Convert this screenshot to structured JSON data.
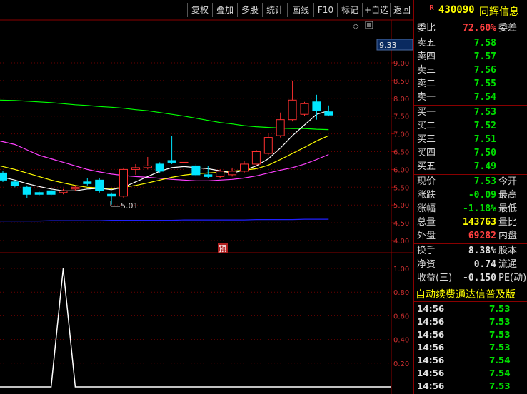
{
  "toolbar": {
    "buttons": [
      "复权",
      "叠加",
      "多股",
      "统计",
      "画线",
      "F10",
      "标记",
      "+自选",
      "返回"
    ]
  },
  "price_axis": {
    "top_label": "9.33",
    "ticks": [
      "9.00",
      "8.50",
      "8.00",
      "7.50",
      "7.00",
      "6.50",
      "6.00",
      "5.50",
      "5.00",
      "4.50",
      "4.00"
    ]
  },
  "chart_annot": {
    "low_marker": "5.01",
    "pre_marker": "预"
  },
  "sub_axis": {
    "ticks": [
      "1.00",
      "0.80",
      "0.60",
      "0.40",
      "0.20"
    ]
  },
  "header": {
    "badge": "R",
    "code": "430090",
    "name": "同辉信息"
  },
  "weibi": {
    "label": "委比",
    "value": "72.60%",
    "label2": "委差"
  },
  "sell": [
    {
      "label": "卖五",
      "price": "7.58"
    },
    {
      "label": "卖四",
      "price": "7.57"
    },
    {
      "label": "卖三",
      "price": "7.56"
    },
    {
      "label": "卖二",
      "price": "7.55"
    },
    {
      "label": "卖一",
      "price": "7.54"
    }
  ],
  "buy": [
    {
      "label": "买一",
      "price": "7.53"
    },
    {
      "label": "买二",
      "price": "7.52"
    },
    {
      "label": "买三",
      "price": "7.51"
    },
    {
      "label": "买四",
      "price": "7.50"
    },
    {
      "label": "买五",
      "price": "7.49"
    }
  ],
  "quote": [
    {
      "label": "现价",
      "value": "7.53",
      "label2": "今开",
      "color": "grn"
    },
    {
      "label": "涨跌",
      "value": "-0.09",
      "label2": "最高",
      "color": "grn"
    },
    {
      "label": "涨幅",
      "value": "-1.18%",
      "label2": "最低",
      "color": "grn"
    },
    {
      "label": "总量",
      "value": "143763",
      "label2": "量比",
      "color": "yel"
    },
    {
      "label": "外盘",
      "value": "69282",
      "label2": "内盘",
      "color": "red"
    }
  ],
  "stats": [
    {
      "label": "换手",
      "value": "8.38%",
      "label2": "股本"
    },
    {
      "label": "净资",
      "value": "0.74",
      "label2": "流通"
    },
    {
      "label": "收益(三)",
      "value": "-0.150",
      "label2": "PE(动)"
    }
  ],
  "notice": "自动续费通达信普及版",
  "ticks": [
    {
      "time": "14:56",
      "price": "7.53"
    },
    {
      "time": "14:56",
      "price": "7.53"
    },
    {
      "time": "14:56",
      "price": "7.53"
    },
    {
      "time": "14:56",
      "price": "7.53"
    },
    {
      "time": "14:56",
      "price": "7.54"
    },
    {
      "time": "14:56",
      "price": "7.54"
    },
    {
      "time": "14:56",
      "price": "7.53"
    }
  ],
  "colors": {
    "up": "#ff3030",
    "down": "#00e5ff",
    "ma5": "#ffffff",
    "ma10": "#ffff00",
    "ma20": "#ff40ff",
    "ma60": "#00ff00",
    "ma250": "#2020ff"
  },
  "chart_data": {
    "type": "candlestick",
    "ylim": [
      4.0,
      9.33
    ],
    "candles": [
      {
        "o": 5.9,
        "c": 5.7,
        "h": 5.95,
        "l": 5.65
      },
      {
        "o": 5.65,
        "c": 5.55,
        "h": 5.7,
        "l": 5.5
      },
      {
        "o": 5.5,
        "c": 5.3,
        "h": 5.55,
        "l": 5.2
      },
      {
        "o": 5.35,
        "c": 5.3,
        "h": 5.4,
        "l": 5.25
      },
      {
        "o": 5.4,
        "c": 5.3,
        "h": 5.45,
        "l": 5.25
      },
      {
        "o": 5.35,
        "c": 5.4,
        "h": 5.45,
        "l": 5.3
      },
      {
        "o": 5.45,
        "c": 5.5,
        "h": 5.55,
        "l": 5.4
      },
      {
        "o": 5.65,
        "c": 5.6,
        "h": 5.75,
        "l": 5.55
      },
      {
        "o": 5.7,
        "c": 5.4,
        "h": 5.75,
        "l": 5.35
      },
      {
        "o": 5.3,
        "c": 5.25,
        "h": 5.35,
        "l": 5.01
      },
      {
        "o": 5.25,
        "c": 6.0,
        "h": 6.05,
        "l": 5.2
      },
      {
        "o": 6.0,
        "c": 6.05,
        "h": 6.15,
        "l": 5.85
      },
      {
        "o": 6.05,
        "c": 6.1,
        "h": 6.35,
        "l": 6.0
      },
      {
        "o": 6.15,
        "c": 5.95,
        "h": 6.2,
        "l": 5.9
      },
      {
        "o": 6.25,
        "c": 6.2,
        "h": 6.95,
        "l": 6.15
      },
      {
        "o": 6.2,
        "c": 6.2,
        "h": 6.3,
        "l": 6.1
      },
      {
        "o": 6.1,
        "c": 5.85,
        "h": 6.15,
        "l": 5.8
      },
      {
        "o": 5.85,
        "c": 5.8,
        "h": 6.1,
        "l": 5.75
      },
      {
        "o": 5.8,
        "c": 5.95,
        "h": 6.0,
        "l": 5.75
      },
      {
        "o": 5.85,
        "c": 5.95,
        "h": 6.05,
        "l": 5.8
      },
      {
        "o": 5.95,
        "c": 6.15,
        "h": 6.25,
        "l": 5.9
      },
      {
        "o": 6.15,
        "c": 6.5,
        "h": 6.55,
        "l": 6.1
      },
      {
        "o": 6.45,
        "c": 6.9,
        "h": 7.0,
        "l": 6.4
      },
      {
        "o": 6.95,
        "c": 7.4,
        "h": 7.6,
        "l": 6.9
      },
      {
        "o": 7.4,
        "c": 7.95,
        "h": 8.5,
        "l": 7.35
      },
      {
        "o": 7.55,
        "c": 7.85,
        "h": 7.9,
        "l": 7.5
      },
      {
        "o": 7.9,
        "c": 7.65,
        "h": 8.1,
        "l": 7.4
      },
      {
        "o": 7.62,
        "c": 7.53,
        "h": 7.8,
        "l": 7.5
      }
    ],
    "ma5": [
      5.8,
      5.7,
      5.6,
      5.52,
      5.45,
      5.4,
      5.4,
      5.45,
      5.47,
      5.43,
      5.5,
      5.65,
      5.8,
      5.95,
      6.05,
      6.08,
      6.05,
      6.02,
      5.96,
      5.9,
      5.98,
      6.1,
      6.3,
      6.6,
      6.95,
      7.25,
      7.55,
      7.65
    ],
    "ma10": [
      6.1,
      6.0,
      5.9,
      5.8,
      5.7,
      5.62,
      5.55,
      5.5,
      5.48,
      5.46,
      5.5,
      5.55,
      5.62,
      5.7,
      5.78,
      5.84,
      5.88,
      5.9,
      5.92,
      5.95,
      5.98,
      6.02,
      6.12,
      6.28,
      6.45,
      6.62,
      6.8,
      6.95
    ],
    "ma20": [
      6.8,
      6.7,
      6.55,
      6.4,
      6.3,
      6.2,
      6.1,
      6.0,
      5.93,
      5.87,
      5.83,
      5.8,
      5.78,
      5.75,
      5.72,
      5.7,
      5.68,
      5.68,
      5.7,
      5.72,
      5.76,
      5.82,
      5.9,
      5.98,
      6.05,
      6.15,
      6.28,
      6.42
    ],
    "ma60": [
      7.95,
      7.94,
      7.92,
      7.9,
      7.88,
      7.85,
      7.82,
      7.8,
      7.77,
      7.75,
      7.72,
      7.68,
      7.65,
      7.6,
      7.55,
      7.5,
      7.44,
      7.38,
      7.32,
      7.28,
      7.23,
      7.2,
      7.18,
      7.16,
      7.15,
      7.15,
      7.13,
      7.12
    ],
    "ma250": [
      4.55,
      4.55,
      4.55,
      4.55,
      4.56,
      4.56,
      4.56,
      4.56,
      4.56,
      4.57,
      4.57,
      4.57,
      4.57,
      4.57,
      4.57,
      4.58,
      4.58,
      4.58,
      4.58,
      4.58,
      4.58,
      4.59,
      4.59,
      4.59,
      4.59,
      4.6,
      4.6,
      4.6
    ],
    "sub_ylim": [
      0,
      1.1
    ],
    "sub_values": [
      0,
      0,
      0,
      0,
      0,
      1,
      0,
      0,
      0,
      0,
      0,
      0,
      0,
      0,
      0,
      0,
      0,
      0,
      0,
      0,
      0,
      0,
      0,
      0,
      0,
      0,
      0,
      0
    ]
  }
}
